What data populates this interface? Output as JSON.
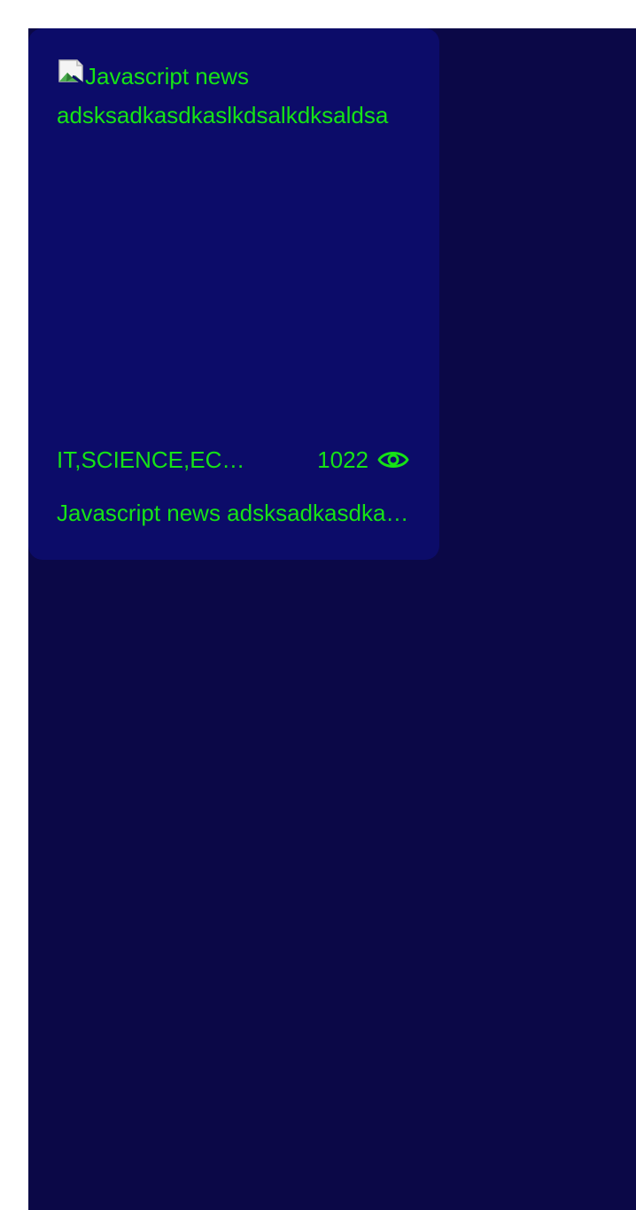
{
  "news_card": {
    "image_alt": "Javascript news adsksadkasdkaslkdsalkdksaldsa",
    "categories": "IT,SCIENCE,ECONOMY",
    "views": "1022",
    "title": "Javascript news adsksadkasdkaslkdsalkdksaldsa",
    "view_icon": "eye-icon",
    "text_color": "#16e316",
    "card_color": "#0c0c69",
    "page_color": "#0b0847"
  }
}
